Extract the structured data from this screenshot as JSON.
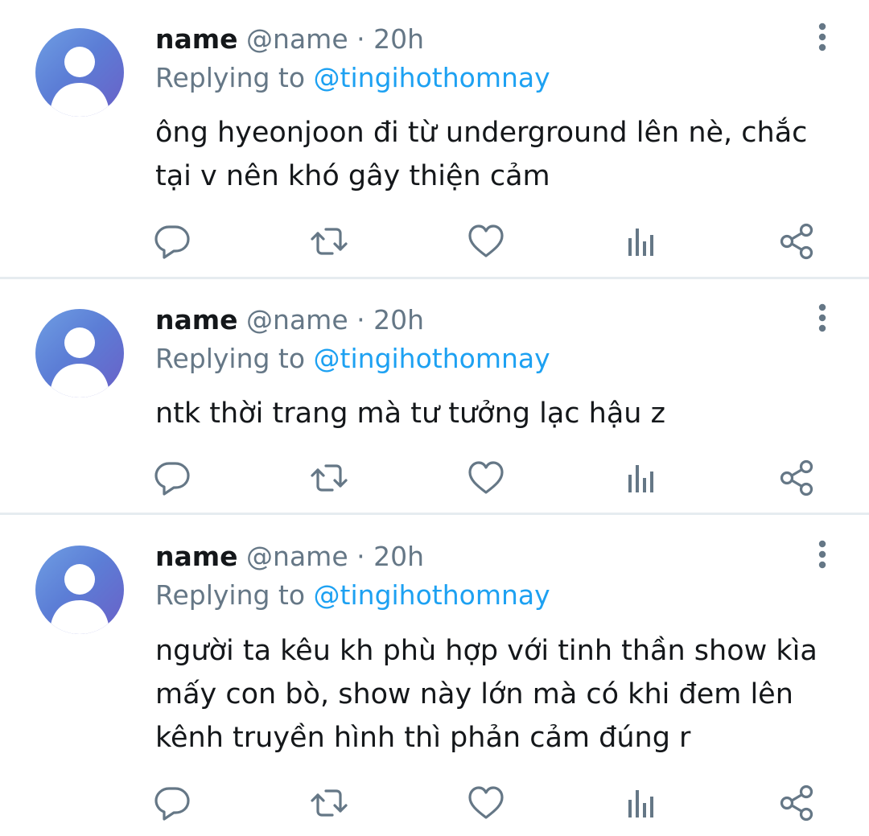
{
  "tweets": [
    {
      "display_name": "name",
      "handle": "@name",
      "separator": "·",
      "time": "20h",
      "replying_label": "Replying to",
      "replying_to": "@tingihothomnay",
      "text_lines": [
        "ông hyeonjoon đi từ underground lên nè, chắc",
        "tại v nên khó gây thiện cảm"
      ],
      "actions": [
        "reply-icon",
        "retweet-icon",
        "like-icon",
        "analytics-icon",
        "share-icon"
      ]
    },
    {
      "display_name": "name",
      "handle": "@name",
      "separator": "·",
      "time": "20h",
      "replying_label": "Replying to",
      "replying_to": "@tingihothomnay",
      "text_lines": [
        "ntk thời trang mà tư tưởng lạc hậu z"
      ],
      "actions": [
        "reply-icon",
        "retweet-icon",
        "like-icon",
        "analytics-icon",
        "share-icon"
      ]
    },
    {
      "display_name": "name",
      "handle": "@name",
      "separator": "·",
      "time": "20h",
      "replying_label": "Replying to",
      "replying_to": "@tingihothomnay",
      "text_lines": [
        "người ta kêu kh phù hợp với tinh thần show kìa",
        "mấy con bò, show này lớn mà có khi đem lên",
        "kênh truyền hình thì phản cảm đúng r"
      ],
      "actions": [
        "reply-icon",
        "retweet-icon",
        "like-icon",
        "analytics-icon",
        "share-icon"
      ]
    }
  ],
  "colors": {
    "name": "#14171a",
    "secondary": "#657786",
    "mention": "#1da1f2",
    "divider": "#e6ecf0",
    "avatar_gradient": [
      "#6f9ee3",
      "#5c7ed6",
      "#6a5fc7"
    ]
  }
}
